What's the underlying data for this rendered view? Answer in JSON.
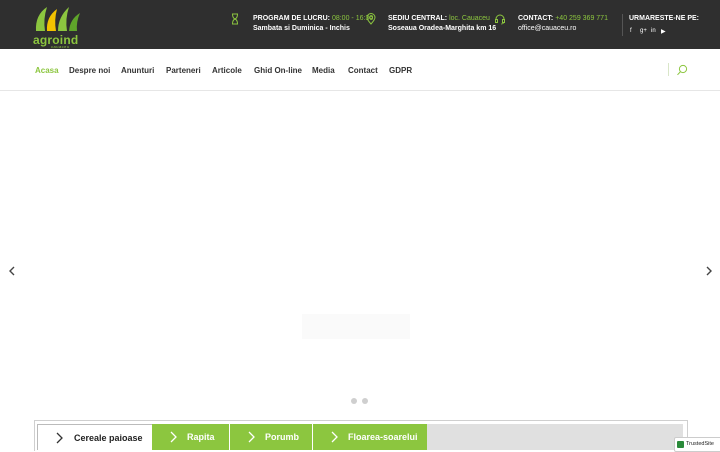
{
  "header": {
    "logo": {
      "name": "agroind",
      "sub": "cauaceu"
    },
    "hours": {
      "label": "PROGRAM DE LUCRU:",
      "value": "08:00 - 16:30",
      "line2": "Sambata si Duminica - Inchis"
    },
    "hq": {
      "label": "SEDIU CENTRAL:",
      "value": "loc. Cauaceu",
      "line2": "Soseaua Oradea-Marghita km 16"
    },
    "contact": {
      "label": "CONTACT:",
      "value": "+40 259 369 771",
      "line2": "office@cauaceu.ro"
    },
    "social": {
      "label": "URMARESTE-NE PE:",
      "facebook": "f",
      "googleplus": "g+",
      "linkedin": "in",
      "youtube": "▶"
    }
  },
  "nav": {
    "items": [
      "Acasa",
      "Despre noi",
      "Anunturi",
      "Parteneri",
      "Articole",
      "Ghid On-line",
      "Media",
      "Contact",
      "GDPR"
    ]
  },
  "tabs": [
    "Cereale paioase",
    "Rapita",
    "Porumb",
    "Floarea-soarelui"
  ],
  "trusted": "TrustedSite",
  "colors": {
    "accent": "#8cc63f",
    "topbar": "#2f2f2f"
  }
}
